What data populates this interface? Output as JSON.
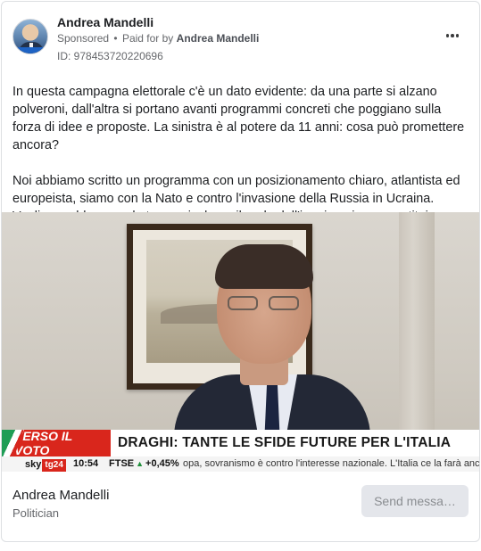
{
  "post": {
    "author": "Andrea Mandelli",
    "sponsored": "Sponsored",
    "separator": "•",
    "paid_for_by_label": "Paid for by",
    "paid_for_by_name": "Andrea Mandelli",
    "ad_id": "ID: 978453720220696",
    "paragraphs": [
      "In questa campagna elettorale c'è un dato evidente: da una parte si alzano polveroni, dall'altra si portano avanti programmi concreti che poggiano sulla forza di idee e proposte. La sinistra è al potere da 11 anni: cosa può promettere ancora?",
      "Noi abbiamo scritto un programma con un posizionamento chiaro, atlantista ed europeista, siamo con la Nato e contro l'invasione della Russia in Ucraina. Vogliamo abbassare le tasse, risolvere il nodo dell'immigrazione e restituire…"
    ]
  },
  "media": {
    "tv_label": "VERSO IL VOTO",
    "headline": "DRAGHI: TANTE LE SFIDE FUTURE PER L'ITALIA",
    "channel_sky": "sky",
    "channel_tg": "tg24",
    "time": "10:54",
    "index_name": "FTSE",
    "index_change": "+0,45%",
    "ticker_text": "opa, sovranismo è contro l'interesse nazionale. L'Italia ce la farà anche quest"
  },
  "footer": {
    "page_name": "Andrea Mandelli",
    "page_category": "Politician",
    "cta_label": "Send messa…"
  },
  "icons": {
    "more": "more-options-icon"
  },
  "colors": {
    "tv_red": "#d9261c",
    "muted_text": "#65676b",
    "button_bg": "#e4e6eb"
  }
}
